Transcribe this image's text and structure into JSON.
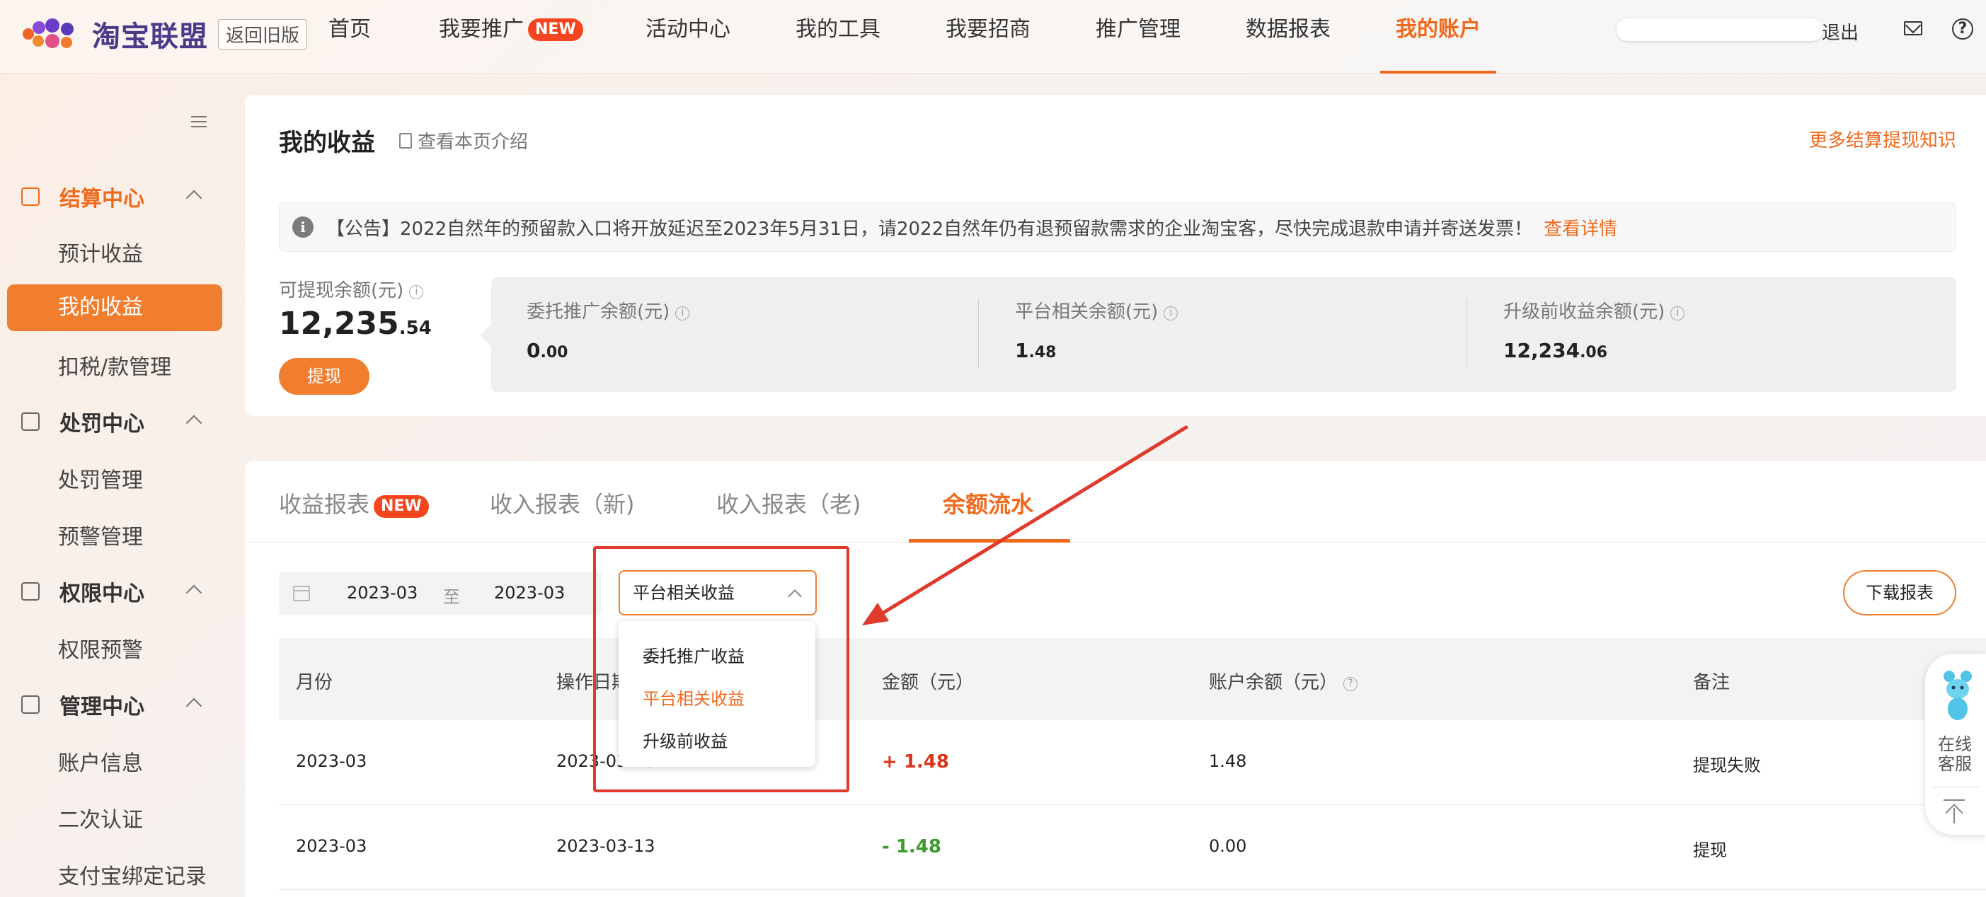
{
  "header": {
    "logo_text": "淘宝联盟",
    "old_version": "返回旧版",
    "nav": [
      {
        "label": "首页"
      },
      {
        "label": "我要推广",
        "badge": "NEW"
      },
      {
        "label": "活动中心"
      },
      {
        "label": "我的工具"
      },
      {
        "label": "我要招商"
      },
      {
        "label": "推广管理"
      },
      {
        "label": "数据报表"
      },
      {
        "label": "我的账户",
        "active": true
      }
    ],
    "logout": "退出",
    "icons": [
      "mail-icon",
      "help-icon"
    ]
  },
  "sidebar": {
    "groups": [
      {
        "label": "结算中心",
        "items": [
          "预计收益",
          "我的收益",
          "扣税/款管理"
        ],
        "active_item": "我的收益"
      },
      {
        "label": "处罚中心",
        "items": [
          "处罚管理",
          "预警管理"
        ]
      },
      {
        "label": "权限中心",
        "items": [
          "权限预警"
        ]
      },
      {
        "label": "管理中心",
        "items": [
          "账户信息",
          "二次认证",
          "支付宝绑定记录"
        ]
      }
    ]
  },
  "summary": {
    "title": "我的收益",
    "intro_link": "查看本页介绍",
    "more_link": "更多结算提现知识",
    "notice": "【公告】2022自然年的预留款入口将开放延迟至2023年5月31日，请2022自然年仍有退预留款需求的企业淘宝客，尽快完成退款申请并寄送发票！",
    "notice_link": "查看详情",
    "available_label": "可提现余额(元)",
    "available_int": "12,235",
    "available_dec": ".54",
    "withdraw_btn": "提现",
    "sub_balances": [
      {
        "label": "委托推广余额(元)",
        "int": "0",
        "dec": ".00"
      },
      {
        "label": "平台相关余额(元)",
        "int": "1",
        "dec": ".48"
      },
      {
        "label": "升级前收益余额(元)",
        "int": "12,234",
        "dec": ".06"
      }
    ]
  },
  "report": {
    "tabs": [
      {
        "label": "收益报表",
        "badge": "NEW"
      },
      {
        "label": "收入报表（新)"
      },
      {
        "label": "收入报表（老)"
      },
      {
        "label": "余额流水",
        "active": true
      }
    ],
    "date_from": "2023-03",
    "date_sep": "至",
    "date_to": "2023-03",
    "select_value": "平台相关收益",
    "select_options": [
      "委托推广收益",
      "平台相关收益",
      "升级前收益"
    ],
    "download_btn": "下载报表",
    "columns": [
      "月份",
      "操作日期",
      "金额（元）",
      "账户余额（元）",
      "备注"
    ],
    "rows": [
      {
        "month": "2023-03",
        "date": "2023-03-13",
        "amount": "+ 1.48",
        "balance": "1.48",
        "note": "提现失败"
      },
      {
        "month": "2023-03",
        "date": "2023-03-13",
        "amount": "- 1.48",
        "balance": "0.00",
        "note": "提现"
      }
    ]
  },
  "float_service": {
    "label": "在线客服"
  },
  "colors": {
    "accent": "#f06a1e",
    "annotation": "#e03a2d",
    "positive": "#d8351d",
    "negative": "#3f9a2e"
  }
}
